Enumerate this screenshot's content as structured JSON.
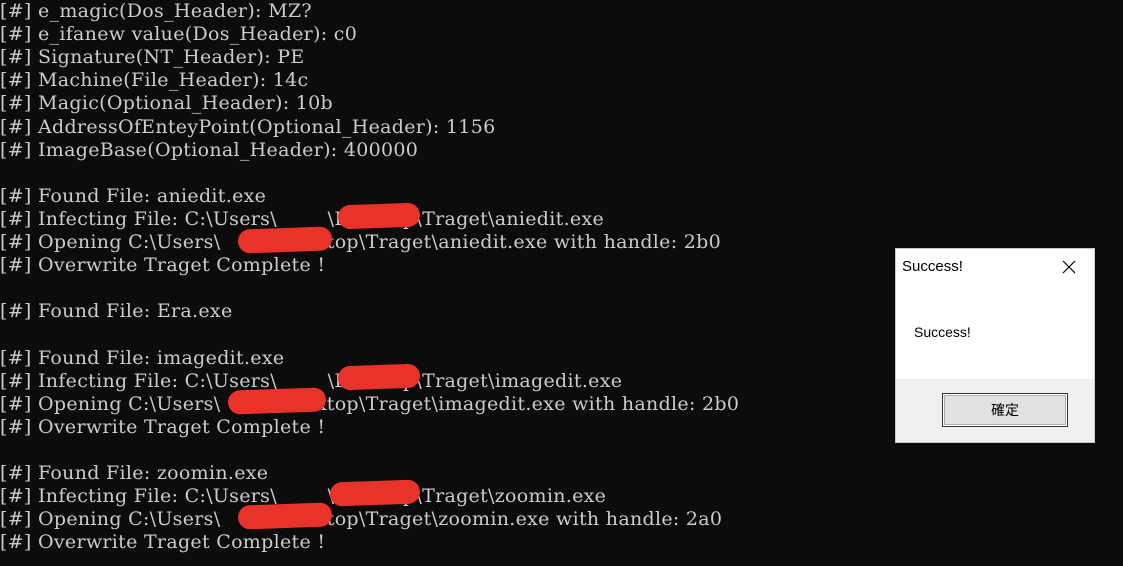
{
  "console": {
    "lines": [
      "[#] e_magic(Dos_Header): MZ?",
      "[#] e_ifanew value(Dos_Header): c0",
      "[#] Signature(NT_Header): PE",
      "[#] Machine(File_Header): 14c",
      "[#] Magic(Optional_Header): 10b",
      "[#] AddressOfEnteyPoint(Optional_Header): 1156",
      "[#] ImageBase(Optional_Header): 400000",
      "",
      "[#] Found File: aniedit.exe",
      "[#] Infecting File: C:\\Users\\        \\Desktop\\Traget\\aniedit.exe",
      "[#] Opening C:\\Users\\        \\Desktop\\Traget\\aniedit.exe with handle: 2b0",
      "[#] Overwrite Traget Complete !",
      "",
      "[#] Found File: Era.exe",
      "",
      "[#] Found File: imagedit.exe",
      "[#] Infecting File: C:\\Users\\        \\Desktop\\Traget\\imagedit.exe",
      "[#] Opening C:\\Users\\        \\Desktop\\Traget\\imagedit.exe with handle: 2b0",
      "[#] Overwrite Traget Complete !",
      "",
      "[#] Found File: zoomin.exe",
      "[#] Infecting File: C:\\Users\\        \\Desktop\\Traget\\zoomin.exe",
      "[#] Opening C:\\Users\\        \\Desktop\\Traget\\zoomin.exe with handle: 2a0",
      "[#] Overwrite Traget Complete !"
    ]
  },
  "dialog": {
    "title": "Success!",
    "message": "Success!",
    "ok_label": "確定",
    "close_icon": "close-icon"
  },
  "colors": {
    "console_background": "#0c0c0c",
    "console_text": "#cccccc",
    "redaction": "#e8322a",
    "dialog_footer": "#f0f0f0"
  }
}
